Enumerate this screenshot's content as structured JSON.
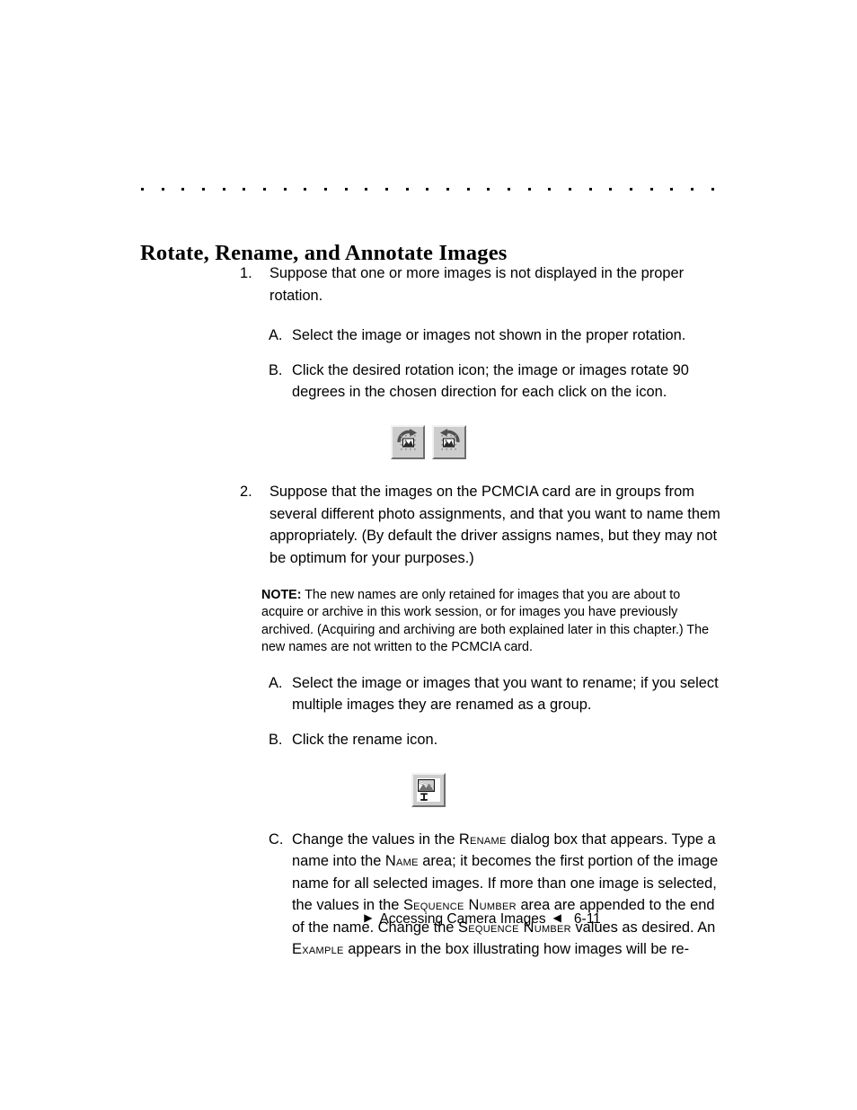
{
  "document": {
    "heading": "Rotate, Rename, and Annotate Images",
    "rule_dot_count": 29
  },
  "steps": [
    {
      "marker": "1.",
      "text": "Suppose that one or more images is not displayed in the proper rotation."
    },
    {
      "marker": "2.",
      "text": "Suppose that the images on the PCMCIA card are in groups from several different photo assignments, and that you want to name them appropriately. (By default the driver assigns names, but they may not be optimum for your purposes.)"
    }
  ],
  "substeps_1": [
    {
      "marker": "A.",
      "text": "Select the image or images not shown in the proper rotation."
    },
    {
      "marker": "B.",
      "text": "Click the desired rotation icon; the image or images rotate 90 degrees in the chosen direction for each click on the icon."
    }
  ],
  "note": {
    "label": "NOTE:",
    "text": " The new names are only retained for images that you are about to acquire or archive in this work session, or for images you have previously archived. (Acquiring and archiving are both explained later in this chapter.) The new names are not written to the PCMCIA card."
  },
  "substeps_2": [
    {
      "marker": "A.",
      "text": "Select the image or images that you want to rename; if you select multiple images they are renamed as a group."
    },
    {
      "marker": "B.",
      "text": "Click the rename icon."
    }
  ],
  "substep_c": {
    "marker": "C.",
    "part1": "Change the values in the ",
    "sc1": "Rename",
    "part2": " dialog box that appears. Type a name into the ",
    "sc2": "Name",
    "part3": " area; it becomes the first portion of the image name for all selected images. If more than one image is selected, the values in the ",
    "sc3": "Sequence Number",
    "part4": " area are appended to the end of the name. Change the ",
    "sc4": "Sequence Number",
    "part5": " values as desired. An ",
    "sc5": "Example",
    "part6": " appears in the box illustrating how images will be re-"
  },
  "icons": {
    "rotate_clockwise": "rotate-clockwise-icon",
    "rotate_counterclockwise": "rotate-counterclockwise-icon",
    "rename": "rename-icon"
  },
  "footer": {
    "left_triangle": "▶",
    "label": "Accessing Camera Images",
    "right_triangle": "◀",
    "page_number": "6-11"
  },
  "colors": {
    "text": "#000000",
    "page_background": "#ffffff",
    "button_face": "#cdcdcd",
    "button_highlight": "#f2f2f2",
    "button_shadow": "#6e6e6e"
  }
}
